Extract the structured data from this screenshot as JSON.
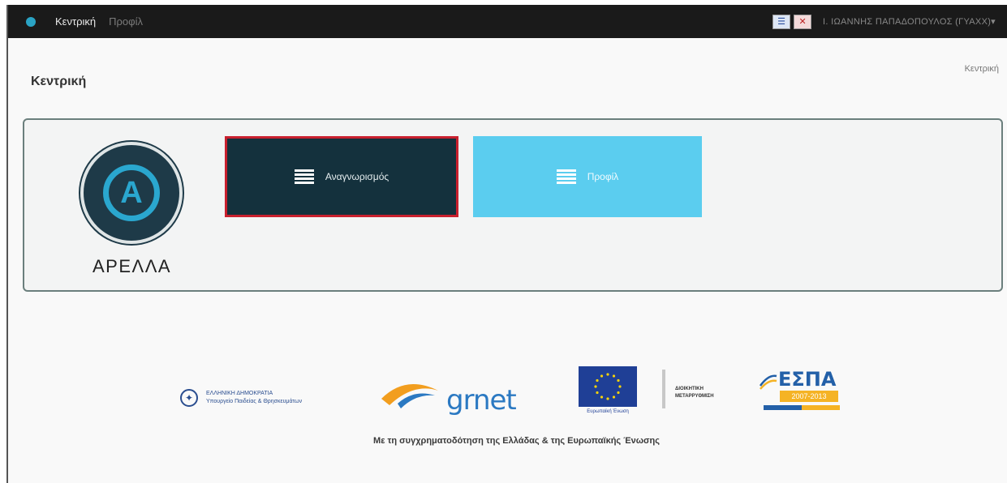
{
  "navbar": {
    "links": [
      "Κεντρική",
      "Προφίλ"
    ],
    "lang_gr": "☰",
    "lang_en": "✕",
    "user": "Ι. ΙΩΑΝΝΗΣ ΠΑΠΑΔΟΠΟΥΛΟΣ (ΓΥΑΧΧ)▾"
  },
  "page": {
    "title": "Κεντρική",
    "breadcrumb": "Κεντρική"
  },
  "logo": {
    "text": "ΑΡΕΛΛΑ"
  },
  "tiles": [
    {
      "label": "Αναγνωρισμός",
      "icon": "list-icon"
    },
    {
      "label": "Προφίλ",
      "icon": "list-icon"
    }
  ],
  "footer": {
    "ministry_line1": "ΕΛΛΗΝΙΚΗ ΔΗΜΟΚΡΑΤΙΑ",
    "ministry_line2": "Υπουργείο Παιδείας & Θρησκευμάτων",
    "grnet": "grnet",
    "eu_caption": "Ευρωπαϊκή Ένωση",
    "dm_line1": "ΔΙΟΙΚΗΤΙΚΗ",
    "dm_line2": "ΜΕΤΑΡΡΥΘΜΙΣΗ",
    "espa": "ΕΣΠΑ",
    "espa_years": "2007-2013",
    "cofund": "Με τη συγχρηματοδότηση της Ελλάδας & της Ευρωπαϊκής Ένωσης"
  },
  "colors": {
    "navbar": "#1a1a1a",
    "tile_dark": "#14313d",
    "tile_highlight_border": "#c8202e",
    "tile_light": "#5bcdef",
    "logo_blue": "#2aa7cf"
  }
}
